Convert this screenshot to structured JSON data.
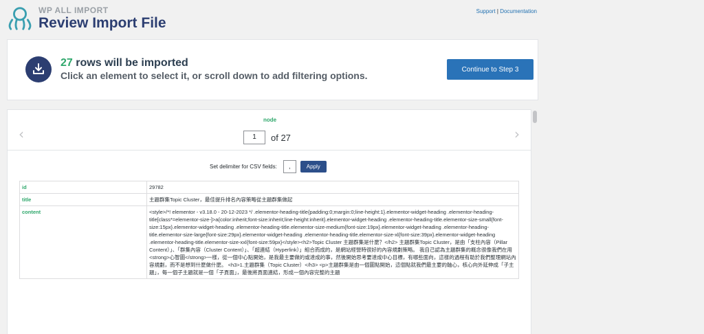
{
  "brand": {
    "name": "WP ALL IMPORT",
    "page_title": "Review Import File",
    "logo_icon": "octopus-logo-icon",
    "color": "#2c3e71",
    "accent": "#3a9fb0"
  },
  "top_links": {
    "support": "Support",
    "separator": "|",
    "documentation": "Documentation"
  },
  "summary": {
    "icon": "import-tray-icon",
    "count": "27",
    "rows_text": "rows will be imported",
    "hint": "Click an element to select it, or scroll down to add filtering options.",
    "continue_label": "Continue to Step 3",
    "accent": "#2ea76b",
    "button_color": "#2a73b8"
  },
  "viewer": {
    "node_label": "node",
    "prev_icon": "chevron-left-icon",
    "next_icon": "chevron-right-icon",
    "current_index": "1",
    "of_text": "of 27",
    "delimiter_label": "Set delimiter for CSV fields:",
    "delimiter_value": ",",
    "apply_label": "Apply"
  },
  "fields": [
    {
      "key": "id",
      "value": "29782"
    },
    {
      "key": "title",
      "value": "主題群集Topic Cluster，最佳提升排名內容策略從主題群集做起"
    },
    {
      "key": "content",
      "value": "<style>/*! elementor - v3.18.0 - 20-12-2023 */ .elementor-heading-title{padding:0;margin:0;line-height:1}.elementor-widget-heading .elementor-heading-title[class*=elementor-size-]>a{color:inherit;font-size:inherit;line-height:inherit}.elementor-widget-heading .elementor-heading-title.elementor-size-small{font-size:15px}.elementor-widget-heading .elementor-heading-title.elementor-size-medium{font-size:19px}.elementor-widget-heading .elementor-heading-title.elementor-size-large{font-size:29px}.elementor-widget-heading .elementor-heading-title.elementor-size-xl{font-size:39px}.elementor-widget-heading .elementor-heading-title.elementor-size-xxl{font-size:59px}</style><h2>Topic Cluster 主題群集是什麼？</h2> 主題群集Topic Cluster，是由「支柱內容（Pillar Content）」、「群集內容（Cluster Content）」、「超連結（Hyperlink）」組合而成的，是網站經營時很好的內容規劃策略。 我自己認為主題群集的概念很像我們在用<strong>心智圖</strong>一樣，從一個中心點開始，是我最主要做的或達成的事，然後開始思考要達成中心目標，有哪些面向，這樣的過程有助於我們整理網站內容規劃，而不是想到什麼做什麼。 <h3>1.主題群集（Topic Cluster）</h3> <p>主題群集是由一個圖點開始，這個點就我們最主要的軸心，核心向外延伸成「子主題」，每一個子主題就是一個「子頁面」，最後將頁面連結，形成一個內容完整的主題"
    }
  ]
}
